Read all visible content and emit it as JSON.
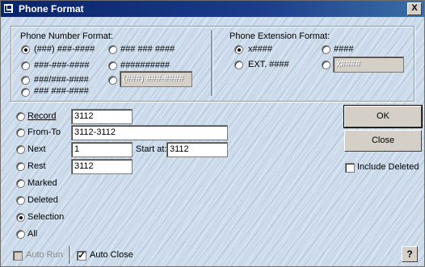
{
  "window": {
    "title": "Phone Format",
    "close_label": "X"
  },
  "phone_number_format": {
    "legend": "Phone Number Format:",
    "options": [
      "(###) ###-####",
      "###-###-####",
      "###/###-####",
      "### ###-####",
      "### ### ####",
      "##########"
    ],
    "custom_value": "(###) ###-####",
    "selected": "(###) ###-####"
  },
  "phone_extension_format": {
    "legend": "Phone Extension Format:",
    "options": [
      "x####",
      "####",
      "EXT. ####"
    ],
    "custom_value": "x####",
    "selected": "x####"
  },
  "range": {
    "record_label": "Record",
    "record_value": "3112",
    "from_to_label": "From-To",
    "from_to_value": "3112-3112",
    "next_label": "Next",
    "next_value": "1",
    "start_at_label": "Start at:",
    "start_at_value": "3112",
    "rest_label": "Rest",
    "rest_value": "3112",
    "marked_label": "Marked",
    "deleted_label": "Deleted",
    "selection_label": "Selection",
    "all_label": "All",
    "selected": "Selection"
  },
  "buttons": {
    "ok": "OK",
    "close": "Close",
    "help": "?"
  },
  "options": {
    "include_deleted_label": "Include Deleted",
    "include_deleted": false,
    "auto_run_label": "Auto Run",
    "auto_run": false,
    "auto_close_label": "Auto Close",
    "auto_close": true
  }
}
